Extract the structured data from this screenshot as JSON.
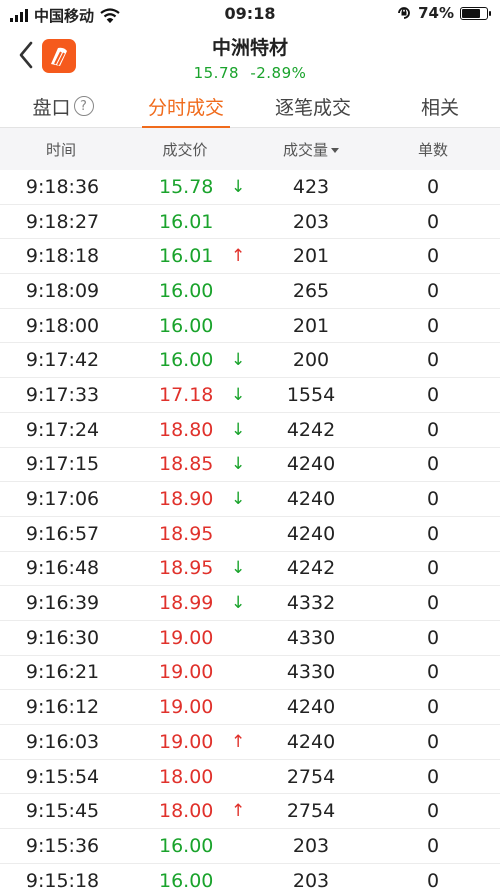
{
  "status_bar": {
    "carrier": "中国移动",
    "time": "09:18",
    "battery": "74%",
    "battery_level": 0.74
  },
  "header": {
    "stock_name": "中洲特材",
    "price": "15.78",
    "change_pct": "-2.89%"
  },
  "tabs": [
    {
      "label": "盘口",
      "help": "?"
    },
    {
      "label": "分时成交"
    },
    {
      "label": "逐笔成交"
    },
    {
      "label": "相关"
    }
  ],
  "active_tab": 1,
  "table": {
    "headers": [
      "时间",
      "成交价",
      "成交量",
      "单数"
    ],
    "rows": [
      {
        "time": "9:18:36",
        "price": "15.78",
        "price_color": "green",
        "arrow": "↓",
        "arrow_color": "green",
        "volume": "423",
        "count": "0"
      },
      {
        "time": "9:18:27",
        "price": "16.01",
        "price_color": "green",
        "arrow": "",
        "arrow_color": "",
        "volume": "203",
        "count": "0"
      },
      {
        "time": "9:18:18",
        "price": "16.01",
        "price_color": "green",
        "arrow": "↑",
        "arrow_color": "red",
        "volume": "201",
        "count": "0"
      },
      {
        "time": "9:18:09",
        "price": "16.00",
        "price_color": "green",
        "arrow": "",
        "arrow_color": "",
        "volume": "265",
        "count": "0"
      },
      {
        "time": "9:18:00",
        "price": "16.00",
        "price_color": "green",
        "arrow": "",
        "arrow_color": "",
        "volume": "201",
        "count": "0"
      },
      {
        "time": "9:17:42",
        "price": "16.00",
        "price_color": "green",
        "arrow": "↓",
        "arrow_color": "green",
        "volume": "200",
        "count": "0"
      },
      {
        "time": "9:17:33",
        "price": "17.18",
        "price_color": "red",
        "arrow": "↓",
        "arrow_color": "green",
        "volume": "1554",
        "count": "0"
      },
      {
        "time": "9:17:24",
        "price": "18.80",
        "price_color": "red",
        "arrow": "↓",
        "arrow_color": "green",
        "volume": "4242",
        "count": "0"
      },
      {
        "time": "9:17:15",
        "price": "18.85",
        "price_color": "red",
        "arrow": "↓",
        "arrow_color": "green",
        "volume": "4240",
        "count": "0"
      },
      {
        "time": "9:17:06",
        "price": "18.90",
        "price_color": "red",
        "arrow": "↓",
        "arrow_color": "green",
        "volume": "4240",
        "count": "0"
      },
      {
        "time": "9:16:57",
        "price": "18.95",
        "price_color": "red",
        "arrow": "",
        "arrow_color": "",
        "volume": "4240",
        "count": "0"
      },
      {
        "time": "9:16:48",
        "price": "18.95",
        "price_color": "red",
        "arrow": "↓",
        "arrow_color": "green",
        "volume": "4242",
        "count": "0"
      },
      {
        "time": "9:16:39",
        "price": "18.99",
        "price_color": "red",
        "arrow": "↓",
        "arrow_color": "green",
        "volume": "4332",
        "count": "0"
      },
      {
        "time": "9:16:30",
        "price": "19.00",
        "price_color": "red",
        "arrow": "",
        "arrow_color": "",
        "volume": "4330",
        "count": "0"
      },
      {
        "time": "9:16:21",
        "price": "19.00",
        "price_color": "red",
        "arrow": "",
        "arrow_color": "",
        "volume": "4330",
        "count": "0"
      },
      {
        "time": "9:16:12",
        "price": "19.00",
        "price_color": "red",
        "arrow": "",
        "arrow_color": "",
        "volume": "4240",
        "count": "0"
      },
      {
        "time": "9:16:03",
        "price": "19.00",
        "price_color": "red",
        "arrow": "↑",
        "arrow_color": "red",
        "volume": "4240",
        "count": "0"
      },
      {
        "time": "9:15:54",
        "price": "18.00",
        "price_color": "red",
        "arrow": "",
        "arrow_color": "",
        "volume": "2754",
        "count": "0"
      },
      {
        "time": "9:15:45",
        "price": "18.00",
        "price_color": "red",
        "arrow": "↑",
        "arrow_color": "red",
        "volume": "2754",
        "count": "0"
      },
      {
        "time": "9:15:36",
        "price": "16.00",
        "price_color": "green",
        "arrow": "",
        "arrow_color": "",
        "volume": "203",
        "count": "0"
      },
      {
        "time": "9:15:18",
        "price": "16.00",
        "price_color": "green",
        "arrow": "",
        "arrow_color": "",
        "volume": "203",
        "count": "0"
      }
    ]
  },
  "colors": {
    "up_red": "#e0312b",
    "down_green": "#1aa32c",
    "accent_orange": "#f06b1c",
    "logo_orange": "#f55a1c"
  },
  "icons": [
    "signal-icon",
    "wifi-icon",
    "orientation-lock-icon",
    "battery-icon",
    "back-chevron-icon",
    "app-logo-icon",
    "help-icon",
    "sort-desc-icon",
    "arrow-down-icon",
    "arrow-up-icon"
  ]
}
